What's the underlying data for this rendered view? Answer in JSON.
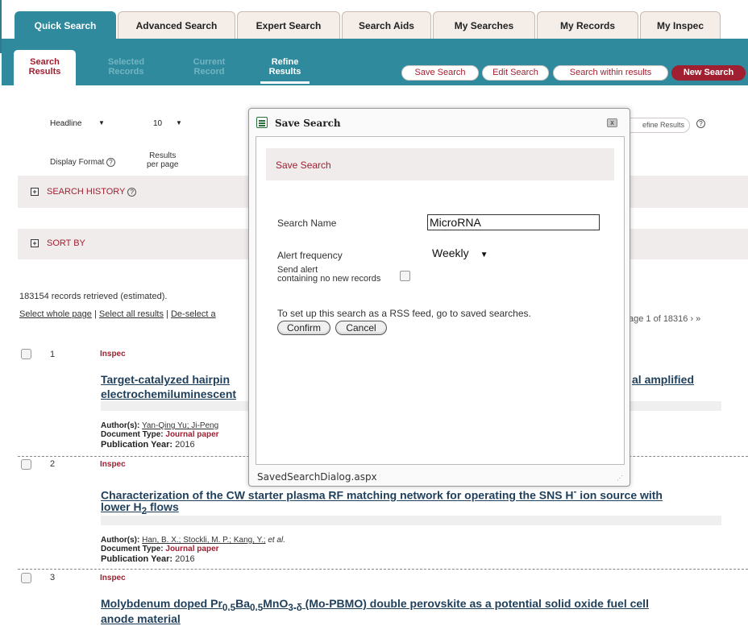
{
  "top_tabs": [
    {
      "label": "Quick Search",
      "active": true
    },
    {
      "label": "Advanced Search",
      "active": false
    },
    {
      "label": "Expert Search",
      "active": false
    },
    {
      "label": "Search Aids",
      "active": false
    },
    {
      "label": "My Searches",
      "active": false
    },
    {
      "label": "My Records",
      "active": false
    },
    {
      "label": "My Inspec",
      "active": false
    }
  ],
  "sub_tabs": {
    "search_results": [
      "Search",
      "Results"
    ],
    "selected_records": [
      "Selected",
      "Records"
    ],
    "current_record": [
      "Current",
      "Record"
    ],
    "refine_results": [
      "Refine",
      "Results"
    ]
  },
  "toolbar": {
    "save_search": "Save Search",
    "edit_search": "Edit Search",
    "search_within": "Search within results",
    "new_search": "New Search"
  },
  "display": {
    "format_value": "Headline",
    "per_page_value": "10",
    "format_label": "Display Format",
    "per_page_label": [
      "Results",
      "per page"
    ],
    "refine_fragment": "efine Results"
  },
  "sections": {
    "search_history": "SEARCH HISTORY",
    "sort_by": "SORT BY"
  },
  "results": {
    "count_text": "183154 records retrieved (estimated).",
    "select_whole_page": "Select whole page",
    "select_all": "Select all results",
    "deselect": "De-select a",
    "pager": "age 1 of 18316 › »",
    "items": [
      {
        "num": "1",
        "db": "Inspec",
        "title_line1": "Target-catalyzed hairpin",
        "title_line1_right": "al amplified",
        "title_line2": "electrochemiluminescent",
        "authors_label": "Author(s):",
        "authors": "Yan-Qing Yu; Ji-Peng",
        "doctype_label": "Document Type:",
        "doctype": "Journal paper",
        "year_label": "Publication Year:",
        "year": "2016"
      },
      {
        "num": "2",
        "db": "Inspec",
        "title_line1": "Characterization of the CW starter plasma RF matching network for operating the SNS H",
        "title_line1_sup": "-",
        "title_line1_end": " ion source with",
        "title_line2": "lower H",
        "title_line2_sub": "2",
        "title_line2_end": " flows",
        "authors_label": "Author(s):",
        "authors": "Han, B. X.; Stockli, M. P.; Kang, Y.;",
        "etal": "et al.",
        "doctype_label": "Document Type:",
        "doctype": "Journal paper",
        "year_label": "Publication Year:",
        "year": "2016"
      },
      {
        "num": "3",
        "db": "Inspec",
        "title_part1": "Molybdenum doped Pr",
        "sub1": "0.5",
        "title_part2": "Ba",
        "sub2": "0.5",
        "title_part3": "MnO",
        "sub3": "3-δ",
        "title_part4": " (Mo-PBMO) double perovskite as a potential solid oxide fuel cell",
        "title_line2": "anode material"
      }
    ]
  },
  "dialog": {
    "title": "Save Search",
    "close": "x",
    "band_title": "Save Search",
    "name_label": "Search Name",
    "name_value": "MicroRNA",
    "alert_label": "Alert frequency",
    "alert_value": "Weekly",
    "send_alert_line1": "Send alert",
    "send_alert_line2": "containing no new records",
    "rss_text": "To set up this search as a RSS feed, go to saved searches.",
    "confirm": "Confirm",
    "cancel": "Cancel",
    "status": "SavedSearchDialog.aspx"
  },
  "colors": {
    "teal": "#2e8a9c",
    "brand_red": "#a01f30",
    "title_blue": "#1f3f5a"
  }
}
